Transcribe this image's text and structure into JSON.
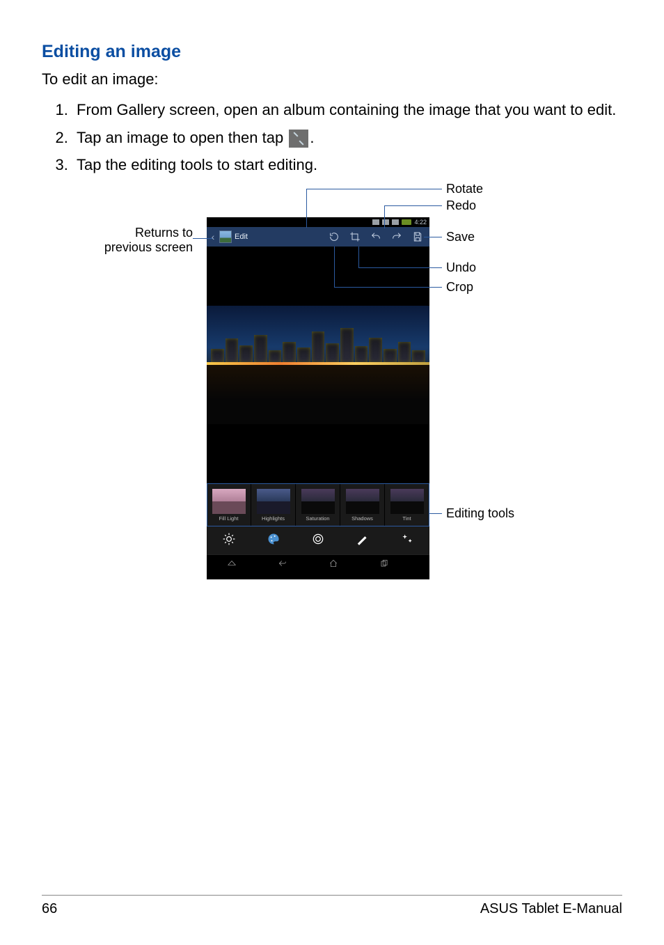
{
  "section_title": "Editing an image",
  "intro": "To edit an image:",
  "steps": {
    "s1": "From Gallery screen, open an album containing the image that you want to edit.",
    "s2a": "Tap an image to open then tap ",
    "s2b": ".",
    "s3": "Tap the editing tools to start editing."
  },
  "callouts": {
    "returns": "Returns to\nprevious screen",
    "rotate": "Rotate",
    "redo": "Redo",
    "save": "Save",
    "undo": "Undo",
    "crop": "Crop",
    "tools": "Editing tools"
  },
  "phone": {
    "status_time": "4:22",
    "edit_label": "Edit",
    "thumbs": [
      "Fill Light",
      "Highlights",
      "Saturation",
      "Shadows",
      "Tint"
    ]
  },
  "footer": {
    "page": "66",
    "doc": "ASUS Tablet E-Manual"
  }
}
